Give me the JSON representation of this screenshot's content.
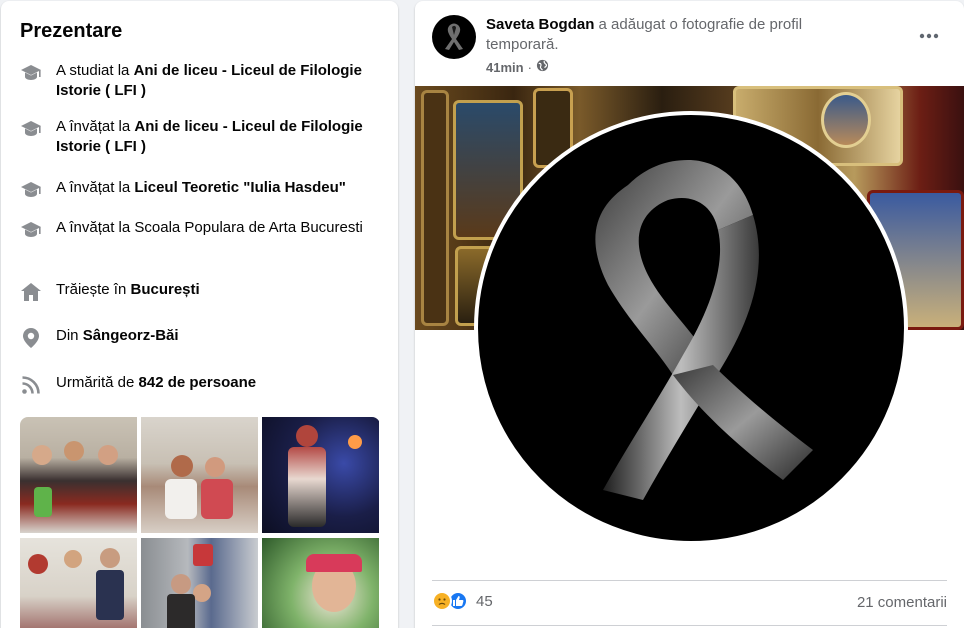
{
  "intro": {
    "title": "Prezentare",
    "rows": [
      {
        "icon": "graduation-cap-icon",
        "pre": "A studiat la ",
        "bold": "Ani de liceu - Liceul de Filologie Istorie ( LFI )",
        "post": ""
      },
      {
        "icon": "graduation-cap-icon",
        "pre": "A învățat la ",
        "bold": "Ani de liceu - Liceul de Filologie Istorie ( LFI )",
        "post": ""
      },
      {
        "icon": "graduation-cap-icon",
        "pre": "A învățat la ",
        "bold": "Liceul Teoretic \"Iulia Hasdeu\"",
        "post": ""
      },
      {
        "icon": "graduation-cap-icon",
        "pre": "A învățat la Scoala Populara de Arta Bucuresti",
        "bold": "",
        "post": ""
      },
      {
        "icon": "home-icon",
        "pre": "Trăiește în ",
        "bold": "București",
        "post": ""
      },
      {
        "icon": "location-pin-icon",
        "pre": "Din ",
        "bold": "Sângeorz-Băi",
        "post": ""
      },
      {
        "icon": "followers-rss-icon",
        "pre": "Urmărită de ",
        "bold": "842 de persoane",
        "post": ""
      }
    ]
  },
  "post": {
    "author": "Saveta Bogdan",
    "action": " a adăugat o fotografie de profil temporară.",
    "time": "41min",
    "separator": "·",
    "privacy_icon": "globe-icon",
    "more_icon": "more-dots-icon",
    "reaction_count": "45",
    "comments": "21 comentarii"
  },
  "colors": {
    "accent": "#1877f2",
    "secondary_text": "#65676b",
    "sad_reaction": "#f7b125"
  }
}
